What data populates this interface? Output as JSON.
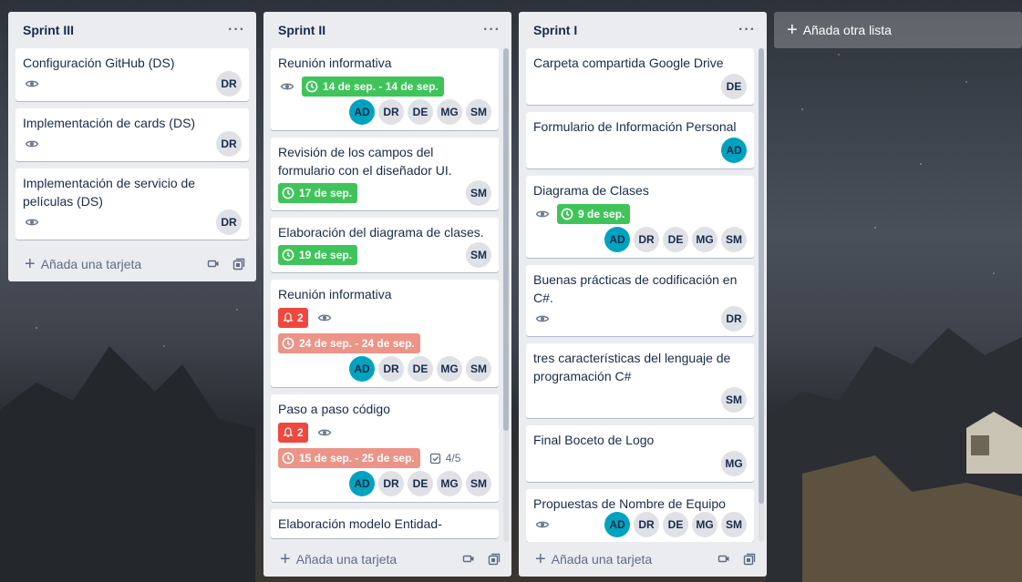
{
  "lists": [
    {
      "title": "Sprint III",
      "menu": "···",
      "cards": [
        {
          "title": "Configuración GitHub (DS)",
          "members": [
            "DR"
          ]
        },
        {
          "title": "Implementación de cards (DS)",
          "members": [
            "DR"
          ]
        },
        {
          "title": "Implementación de servicio de películas (DS)",
          "members": [
            "DR"
          ]
        }
      ],
      "add_card": "Añada una tarjeta"
    },
    {
      "title": "Sprint II",
      "menu": "···",
      "cards": [
        {
          "title": "Reunión informativa",
          "date": "14 de sep. - 14 de sep.",
          "members": [
            "AD",
            "DR",
            "DE",
            "MG",
            "SM"
          ]
        },
        {
          "title": "Revisión de los campos del formulario con el diseñador UI.",
          "date": "17 de sep.",
          "members": [
            "SM"
          ]
        },
        {
          "title": "Elaboración del diagrama de clases.",
          "date": "19 de sep.",
          "members": [
            "SM"
          ]
        },
        {
          "title": "Reunión informativa",
          "notifications": "2",
          "date": "24 de sep. - 24 de sep.",
          "members": [
            "AD",
            "DR",
            "DE",
            "MG",
            "SM"
          ]
        },
        {
          "title": "Paso a paso código",
          "notifications": "2",
          "date": "15 de sep. - 25 de sep.",
          "checklist": "4/5",
          "members": [
            "AD",
            "DR",
            "DE",
            "MG",
            "SM"
          ]
        },
        {
          "title": "Elaboración modelo Entidad-"
        }
      ],
      "add_card": "Añada una tarjeta"
    },
    {
      "title": "Sprint I",
      "menu": "···",
      "cards": [
        {
          "title": "Carpeta compartida Google Drive",
          "members": [
            "DE"
          ]
        },
        {
          "title": "Formulario de Información Personal",
          "members": [
            "AD"
          ]
        },
        {
          "title": "Diagrama de Clases",
          "date": "9 de sep.",
          "members": [
            "AD",
            "DR",
            "DE",
            "MG",
            "SM"
          ]
        },
        {
          "title": "Buenas prácticas de codificación en C#.",
          "members": [
            "DR"
          ]
        },
        {
          "title": "tres características del lenguaje de programación C#",
          "members": [
            "SM"
          ]
        },
        {
          "title": "Final Boceto de Logo",
          "members": [
            "MG"
          ]
        },
        {
          "title": "Propuestas de Nombre de Equipo",
          "members": [
            "AD",
            "DR",
            "DE",
            "MG",
            "SM"
          ]
        }
      ],
      "add_card": "Añada una tarjeta"
    }
  ],
  "add_list": "Añada otra lista",
  "colors": {
    "due_green": "#3fc45a",
    "due_overdue": "#ec9488",
    "notification": "#f0473c",
    "avatar_teal": "#00a3bf"
  }
}
